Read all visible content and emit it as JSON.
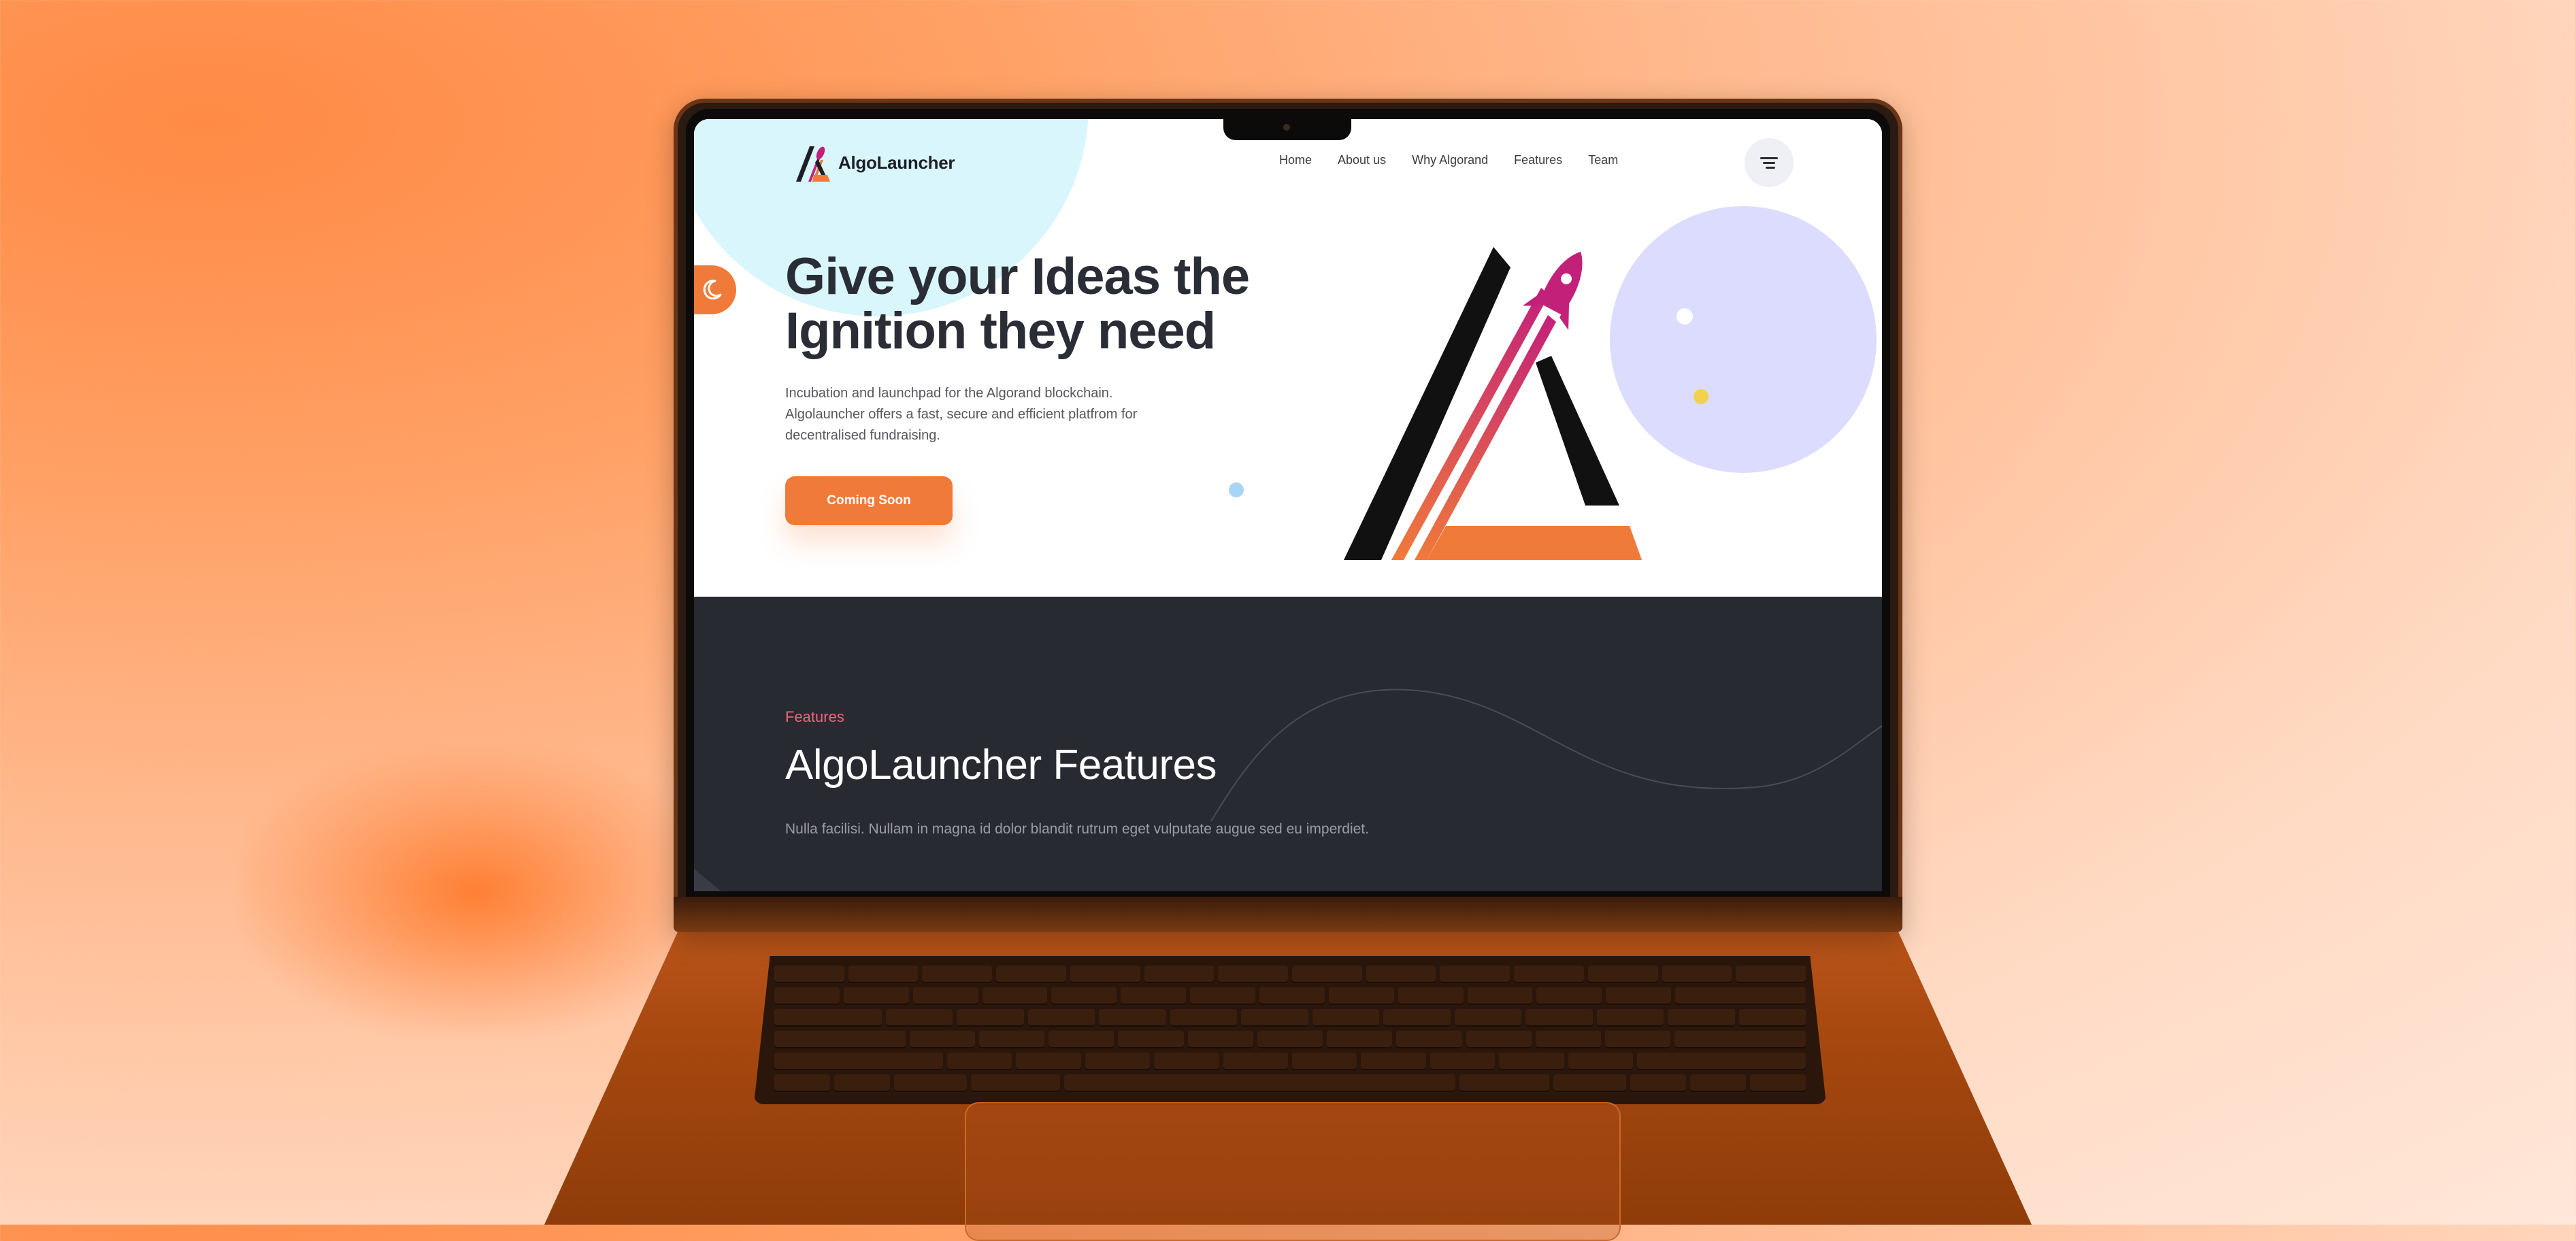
{
  "brand": {
    "name": "AlgoLauncher"
  },
  "nav": {
    "items": [
      "Home",
      "About us",
      "Why Algorand",
      "Features",
      "Team"
    ]
  },
  "hero": {
    "title_line1": "Give your Ideas the",
    "title_line2": "Ignition they need",
    "desc_line1": "Incubation and launchpad for the Algorand blockchain.",
    "desc_line2": "Algolauncher offers a fast, secure and efficient platfrom for",
    "desc_line3": "decentralised fundraising.",
    "cta_label": "Coming Soon"
  },
  "features": {
    "tag": "Features",
    "title": "AlgoLauncher Features",
    "desc": "Nulla facilisi. Nullam in magna id dolor blandit rutrum eget vulputate augue sed eu imperdiet."
  },
  "colors": {
    "accent": "#f07a3a",
    "rocket": "#c3207a",
    "dark_section": "#282a31",
    "feature_tag": "#f06478"
  },
  "icons": [
    "logo-mark-icon",
    "menu-icon",
    "moon-icon",
    "rocket-logo-icon"
  ]
}
